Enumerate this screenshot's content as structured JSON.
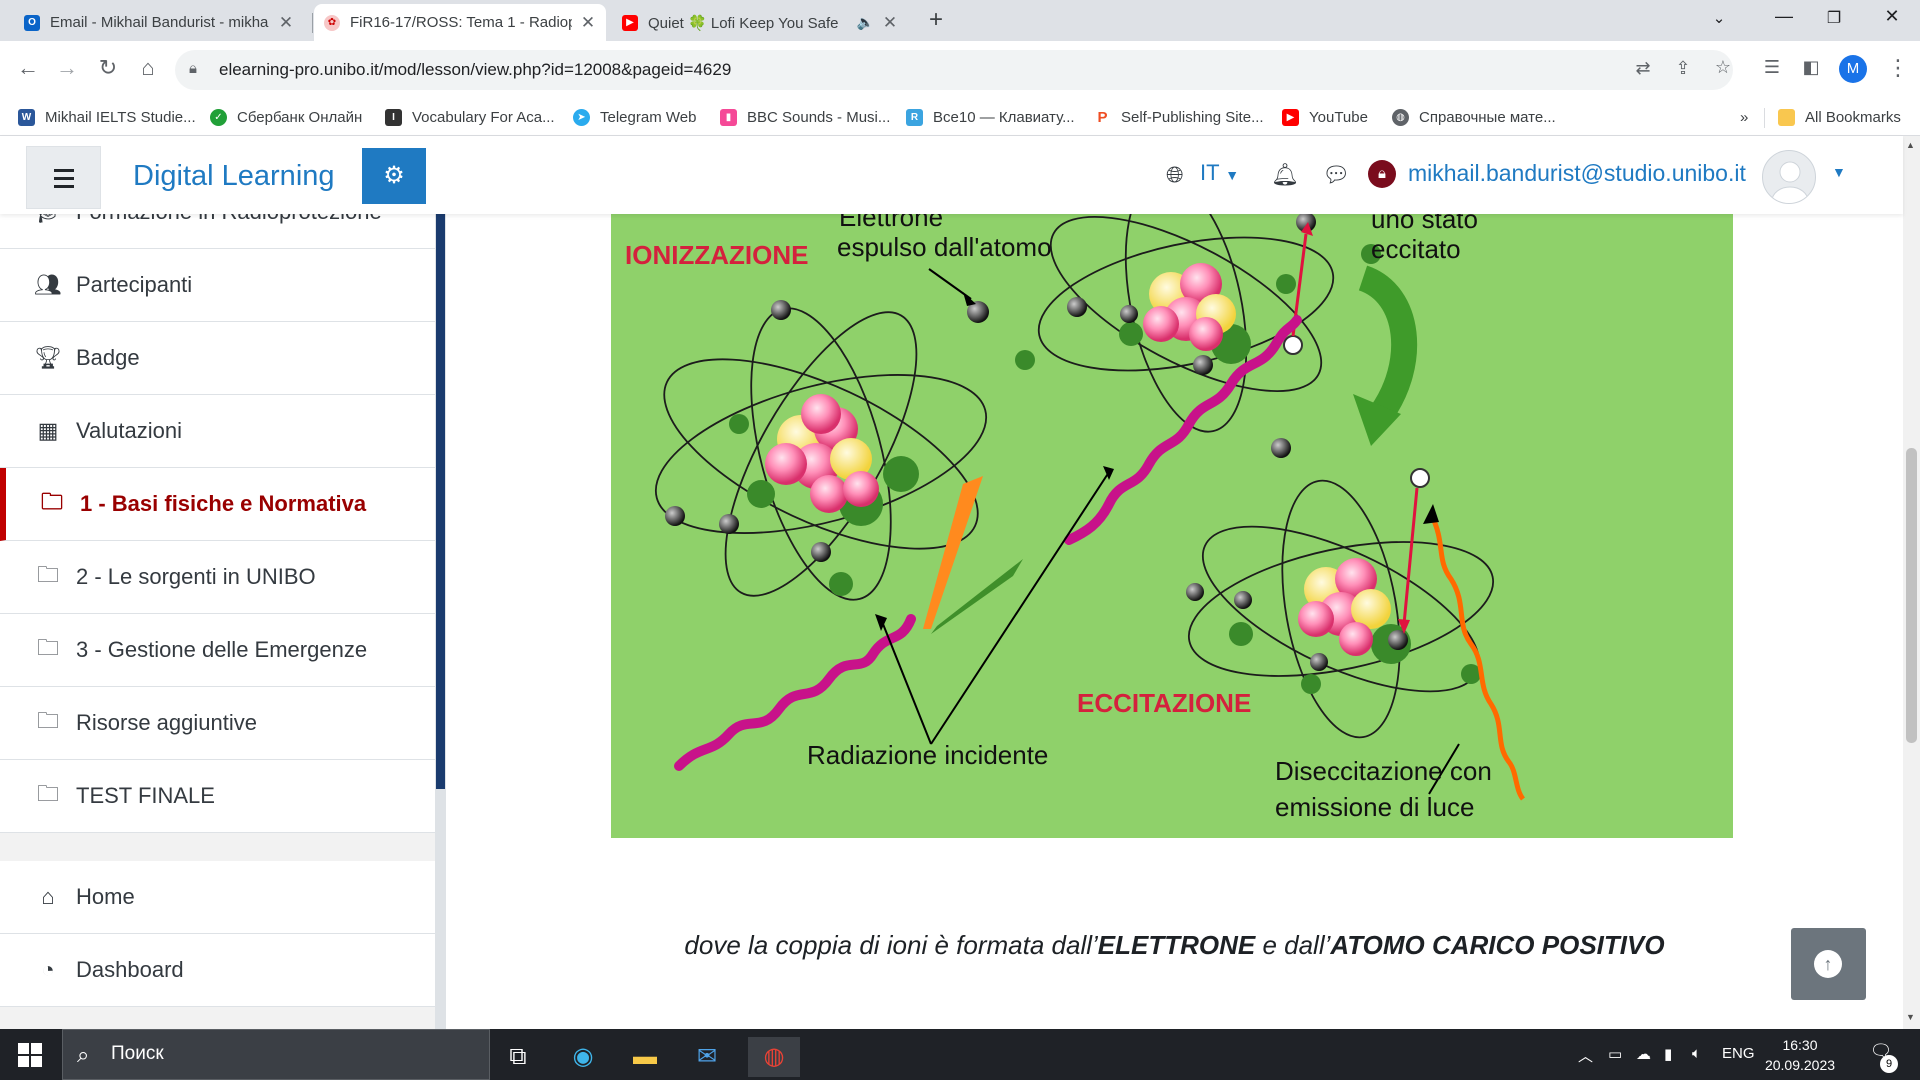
{
  "browser": {
    "tabs": [
      {
        "title": "Email - Mikhail Bandurist - mikha",
        "favicon": "outlook-icon",
        "active": false
      },
      {
        "title": "FiR16-17/ROSS: Tema 1 - Radiop",
        "favicon": "unibo-icon",
        "active": true
      },
      {
        "title": "Quiet 🍀 Lofi Keep You Safe",
        "favicon": "youtube-icon",
        "active": false
      }
    ],
    "url": "elearning-pro.unibo.it/mod/lesson/view.php?id=12008&pageid=4629",
    "profile_initial": "M",
    "bookmarks": [
      {
        "label": "Mikhail IELTS Studie...",
        "color": "#2b579a"
      },
      {
        "label": "Сбербанк Онлайн",
        "color": "#21a038"
      },
      {
        "label": "Vocabulary For Aca...",
        "color": "#333333"
      },
      {
        "label": "Telegram Web",
        "color": "#2aabee"
      },
      {
        "label": "BBC Sounds - Musi...",
        "color": "#f54997"
      },
      {
        "label": "Все10 — Клавиату...",
        "color": "#3ba4e0"
      },
      {
        "label": "Self-Publishing Site...",
        "color": "#ef4e23"
      },
      {
        "label": "YouTube",
        "color": "#ff0000"
      },
      {
        "label": "Справочные мате...",
        "color": "#5f6368"
      }
    ],
    "bookmarks_more": "»",
    "all_bookmarks": "All Bookmarks"
  },
  "navbar": {
    "brand": "Digital Learning",
    "language": "IT",
    "user_email": "mikhail.bandurist@studio.unibo.it"
  },
  "sidebar": {
    "items": [
      {
        "label": "Formazione in Radioprotezione",
        "icon": "graduation-cap-icon",
        "glyph": "🎓",
        "active": false
      },
      {
        "label": "Partecipanti",
        "icon": "users-icon",
        "glyph": "👥",
        "active": false
      },
      {
        "label": "Badge",
        "icon": "trophy-icon",
        "glyph": "🏆",
        "active": false
      },
      {
        "label": "Valutazioni",
        "icon": "table-icon",
        "glyph": "▦",
        "active": false
      },
      {
        "label": "1 - Basi fisiche e Normativa",
        "icon": "folder-icon",
        "glyph": "🗀",
        "active": true
      },
      {
        "label": "2 - Le sorgenti in UNIBO",
        "icon": "folder-icon",
        "glyph": "🗀",
        "active": false
      },
      {
        "label": "3 - Gestione delle Emergenze",
        "icon": "folder-icon",
        "glyph": "🗀",
        "active": false
      },
      {
        "label": "Risorse aggiuntive",
        "icon": "folder-icon",
        "glyph": "🗀",
        "active": false
      },
      {
        "label": "TEST FINALE",
        "icon": "folder-icon",
        "glyph": "🗀",
        "active": false
      }
    ],
    "items2": [
      {
        "label": "Home",
        "icon": "home-icon",
        "glyph": "⌂"
      },
      {
        "label": "Dashboard",
        "icon": "dashboard-icon",
        "glyph": "◔"
      }
    ]
  },
  "figure": {
    "label_ionization": "IONIZZAZIONE",
    "label_excitation": "ECCITAZIONE",
    "label_ejected_1": "Elettrone",
    "label_ejected_2": "espulso  dall'atomo",
    "label_excited_1": "uno  stato",
    "label_excited_2": "eccitato",
    "label_incident": "Radiazione  incidente",
    "label_deexc_1": "Diseccitazione  con",
    "label_deexc_2": "emissione  di  luce",
    "colors": {
      "background": "#8fd16a",
      "ionization_label": "#d4213d",
      "wave": "#c8128a",
      "orange": "#ff8a1e",
      "arrow": "#3f8f2a"
    }
  },
  "caption": {
    "prefix": "dove la coppia di ioni è formata dall’",
    "bold1": "ELETTRONE",
    "middle": " e dall’",
    "bold2": "ATOMO CARICO POSITIVO"
  },
  "taskbar": {
    "search_placeholder": "Поиск",
    "language": "ENG",
    "time": "16:30",
    "date": "20.09.2023",
    "notification_count": "9"
  }
}
